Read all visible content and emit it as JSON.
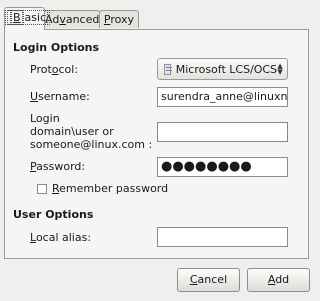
{
  "tabs": {
    "basic": {
      "pre": "",
      "mnemonic": "B",
      "post": "asic"
    },
    "advanced": {
      "pre": "Ad",
      "mnemonic": "v",
      "post": "anced"
    },
    "proxy": {
      "pre": "",
      "mnemonic": "P",
      "post": "roxy"
    }
  },
  "login_options": {
    "title": "Login Options",
    "protocol_label": {
      "pre": "Prot",
      "mnemonic": "o",
      "post": "col:"
    },
    "protocol_value": "Microsoft LCS/OCS",
    "protocol_icon": "window-icon",
    "username_label": {
      "pre": "",
      "mnemonic": "U",
      "post": "sername:"
    },
    "username_value": "surendra_anne@linuxnix.",
    "login_label": {
      "line1": "Login",
      "line2": "domain\\user  or",
      "line3": "someone@linux.com :"
    },
    "login_value": "",
    "password_label": {
      "pre": "",
      "mnemonic": "P",
      "post": "assword:"
    },
    "password_value": "●●●●●●●●",
    "remember_label": {
      "pre": "",
      "mnemonic": "R",
      "post": "emember password"
    },
    "remember_checked": false
  },
  "user_options": {
    "title": "User Options",
    "alias_label": {
      "pre": "",
      "mnemonic": "L",
      "post": "ocal alias:"
    },
    "alias_value": ""
  },
  "buttons": {
    "cancel": {
      "pre": "",
      "mnemonic": "C",
      "post": "ancel"
    },
    "add": {
      "pre": "",
      "mnemonic": "A",
      "post": "dd"
    }
  }
}
